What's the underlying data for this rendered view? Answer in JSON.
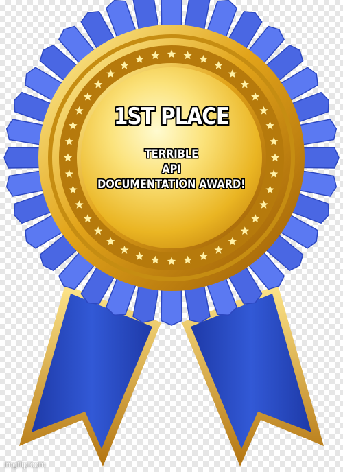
{
  "meme": {
    "headline": "1ST PLACE",
    "subtitle_lines": [
      "TERRIBLE",
      "API",
      "DOCUMENTATION AWARD!"
    ]
  },
  "watermark": "imgflip.com",
  "graphic": {
    "icon": "award-ribbon-icon",
    "colors": {
      "ribbon_blue": "#2d4fc6",
      "rosette_blue": "#5b79f2",
      "gold": "#f2c41f",
      "gold_dark": "#b8740a",
      "gold_light": "#fff6b0"
    }
  }
}
